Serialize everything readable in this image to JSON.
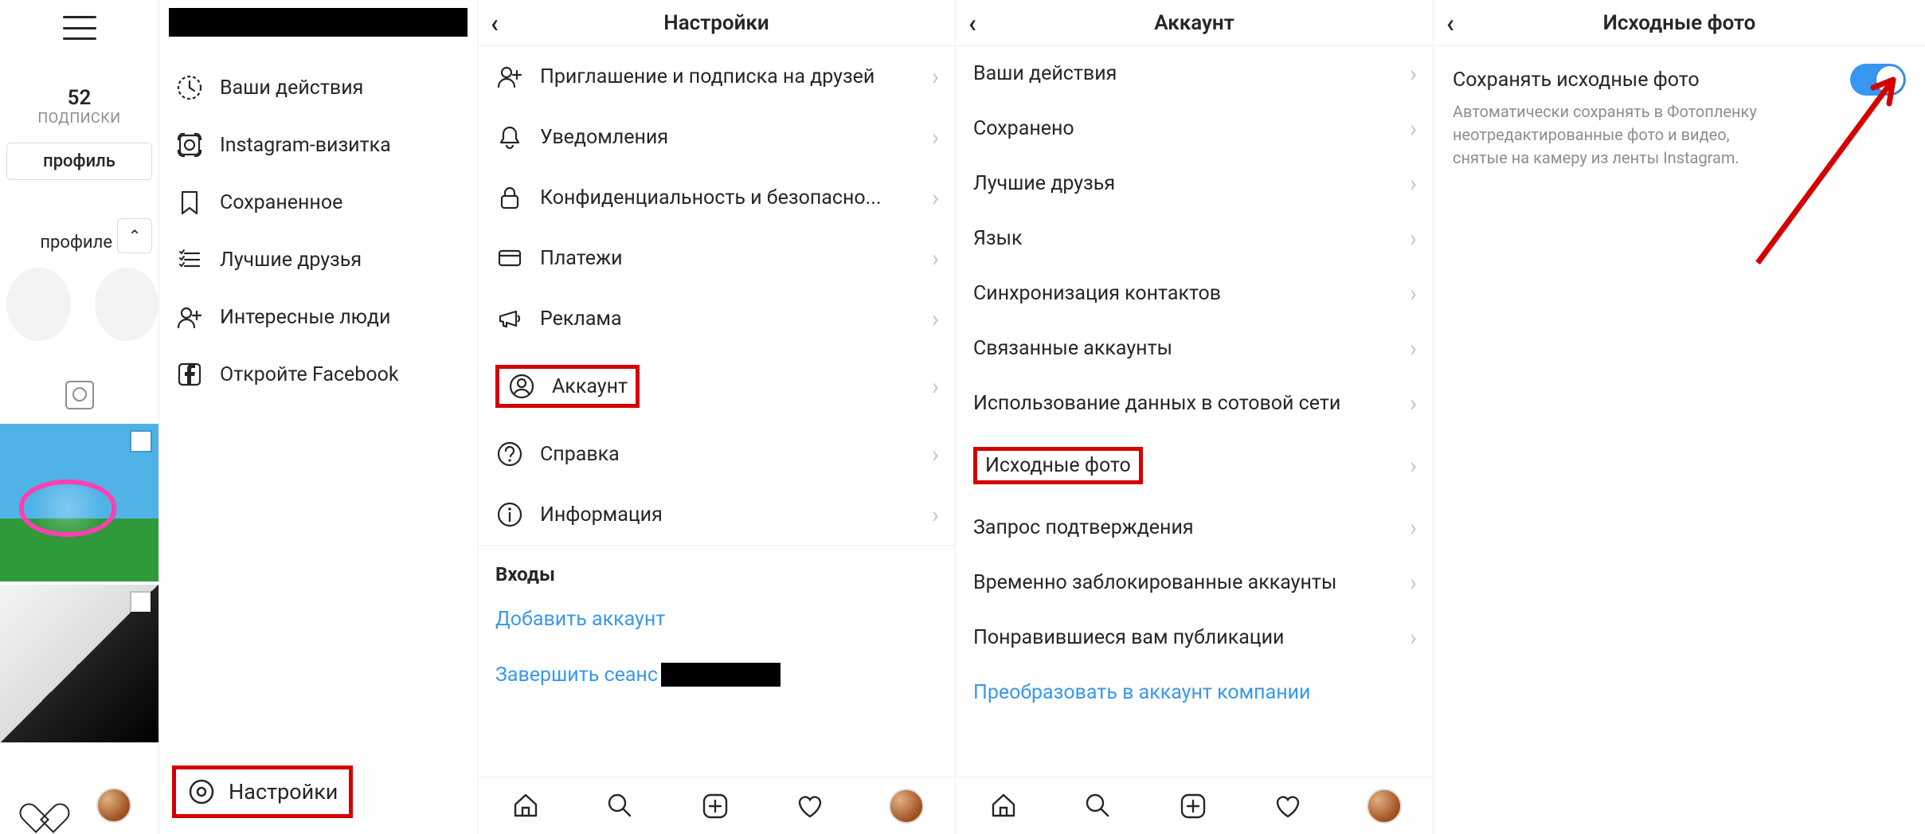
{
  "profile": {
    "stat_value": "52",
    "stat_label": "ПОДПИСКИ",
    "edit_button": "профиль",
    "section_text": "профиле"
  },
  "menu": {
    "items": [
      {
        "icon": "activity",
        "label": "Ваши действия"
      },
      {
        "icon": "nametag",
        "label": "Instagram-визитка"
      },
      {
        "icon": "bookmark",
        "label": "Сохраненное"
      },
      {
        "icon": "list",
        "label": "Лучшие друзья"
      },
      {
        "icon": "adduser",
        "label": "Интересные люди"
      },
      {
        "icon": "facebook",
        "label": "Откройте Facebook"
      }
    ],
    "settings_label": "Настройки"
  },
  "settings": {
    "title": "Настройки",
    "items": [
      {
        "icon": "adduser",
        "label": "Приглашение и подписка на друзей"
      },
      {
        "icon": "bell",
        "label": "Уведомления"
      },
      {
        "icon": "lock",
        "label": "Конфиденциальность и безопасно..."
      },
      {
        "icon": "card",
        "label": "Платежи"
      },
      {
        "icon": "megaphone",
        "label": "Реклама"
      },
      {
        "icon": "user",
        "label": "Аккаунт"
      },
      {
        "icon": "help",
        "label": "Справка"
      },
      {
        "icon": "info",
        "label": "Информация"
      }
    ],
    "section": "Входы",
    "add_account": "Добавить аккаунт",
    "end_session": "Завершить сеанс"
  },
  "account": {
    "title": "Аккаунт",
    "items": [
      "Ваши действия",
      "Сохранено",
      "Лучшие друзья",
      "Язык",
      "Синхронизация контактов",
      "Связанные аккаунты",
      "Использование данных в сотовой сети",
      "Исходные фото",
      "Запрос подтверждения",
      "Временно заблокированные аккаунты",
      "Понравившиеся вам публикации",
      "Преобразовать в аккаунт компании"
    ]
  },
  "photos": {
    "title": "Исходные фото",
    "toggle_label": "Сохранять исходные фото",
    "toggle_desc": "Автоматически сохранять в Фотопленку неотредактированные фото и видео, снятые на камеру из ленты Instagram."
  }
}
